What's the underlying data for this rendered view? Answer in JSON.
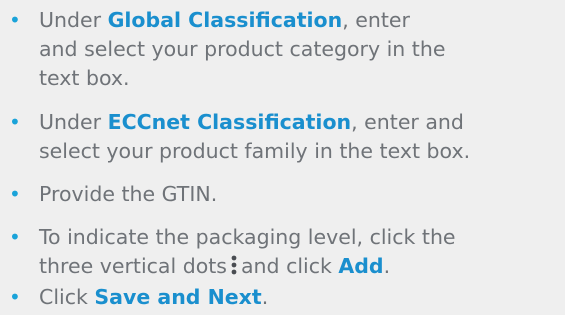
{
  "steps": [
    {
      "pre": "Under ",
      "bold": "Global Classification",
      "post": ", enter\nand select your product category in the\ntext box."
    },
    {
      "pre": "Under ",
      "bold": "ECCnet Classification",
      "post": ", enter and\nselect your product family in the text box."
    },
    {
      "text": "Provide the GTIN."
    },
    {
      "pre": "To indicate the packaging level, click the\nthree vertical dots",
      "icon": "vertical-dots-icon",
      "mid": "and click ",
      "bold": "Add",
      "post": "."
    },
    {
      "pre": "Click ",
      "bold": "Save and Next",
      "post": "."
    }
  ],
  "colors": {
    "text": "#6f7378",
    "accent": "#1a8fce",
    "bullet": "#1aa3d9",
    "background": "#efefef"
  }
}
